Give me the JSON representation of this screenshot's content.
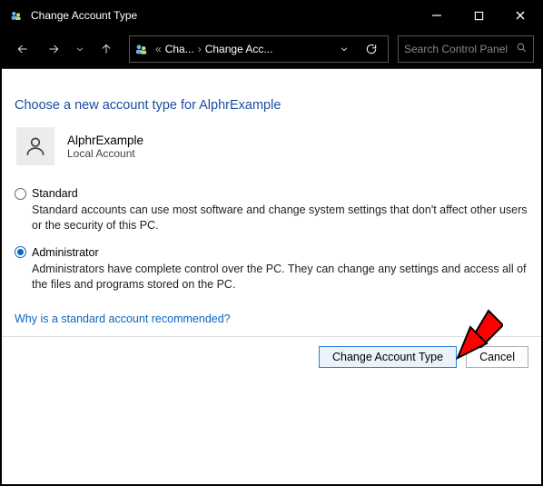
{
  "window": {
    "title": "Change Account Type"
  },
  "breadcrumb": {
    "prefix": "«",
    "seg1": "Cha...",
    "seg2": "Change Acc..."
  },
  "search": {
    "placeholder": "Search Control Panel"
  },
  "page": {
    "heading": "Choose a new account type for AlphrExample"
  },
  "user": {
    "name": "AlphrExample",
    "subtitle": "Local Account"
  },
  "options": {
    "standard": {
      "label": "Standard",
      "description": "Standard accounts can use most software and change system settings that don't affect other users or the security of this PC.",
      "checked": false
    },
    "admin": {
      "label": "Administrator",
      "description": "Administrators have complete control over the PC. They can change any settings and access all of the files and programs stored on the PC.",
      "checked": true
    }
  },
  "help_link": "Why is a standard account recommended?",
  "buttons": {
    "primary": "Change Account Type",
    "cancel": "Cancel"
  },
  "annotation": {
    "arrow_color": "#ff0000"
  }
}
